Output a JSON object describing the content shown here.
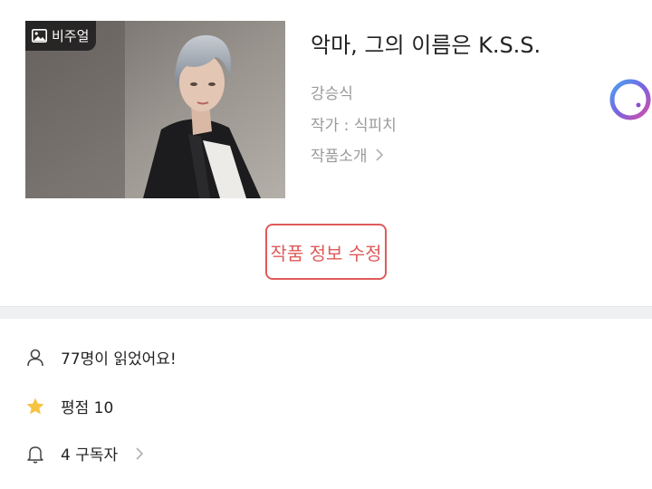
{
  "work": {
    "cover_badge": "비주얼",
    "title": "악마, 그의 이름은 K.S.S.",
    "character": "강승식",
    "writer": "작가 : 식피치",
    "intro_link": "작품소개"
  },
  "actions": {
    "edit_label": "작품 정보 수정"
  },
  "stats": {
    "readers": "77명이 읽었어요!",
    "rating": "평점 10",
    "subscribers": "4 구독자"
  },
  "colors": {
    "accent": "#e05a5a",
    "star": "#f6c343",
    "muted_text": "#9a9a9a",
    "divider_bg": "#eef0f2"
  },
  "icons": {
    "badge": "image-icon",
    "intro": "chevron-right-icon",
    "readers": "user-icon",
    "rating": "star-icon",
    "subscribers": "bell-icon",
    "floating": "floating-ring-icon"
  }
}
